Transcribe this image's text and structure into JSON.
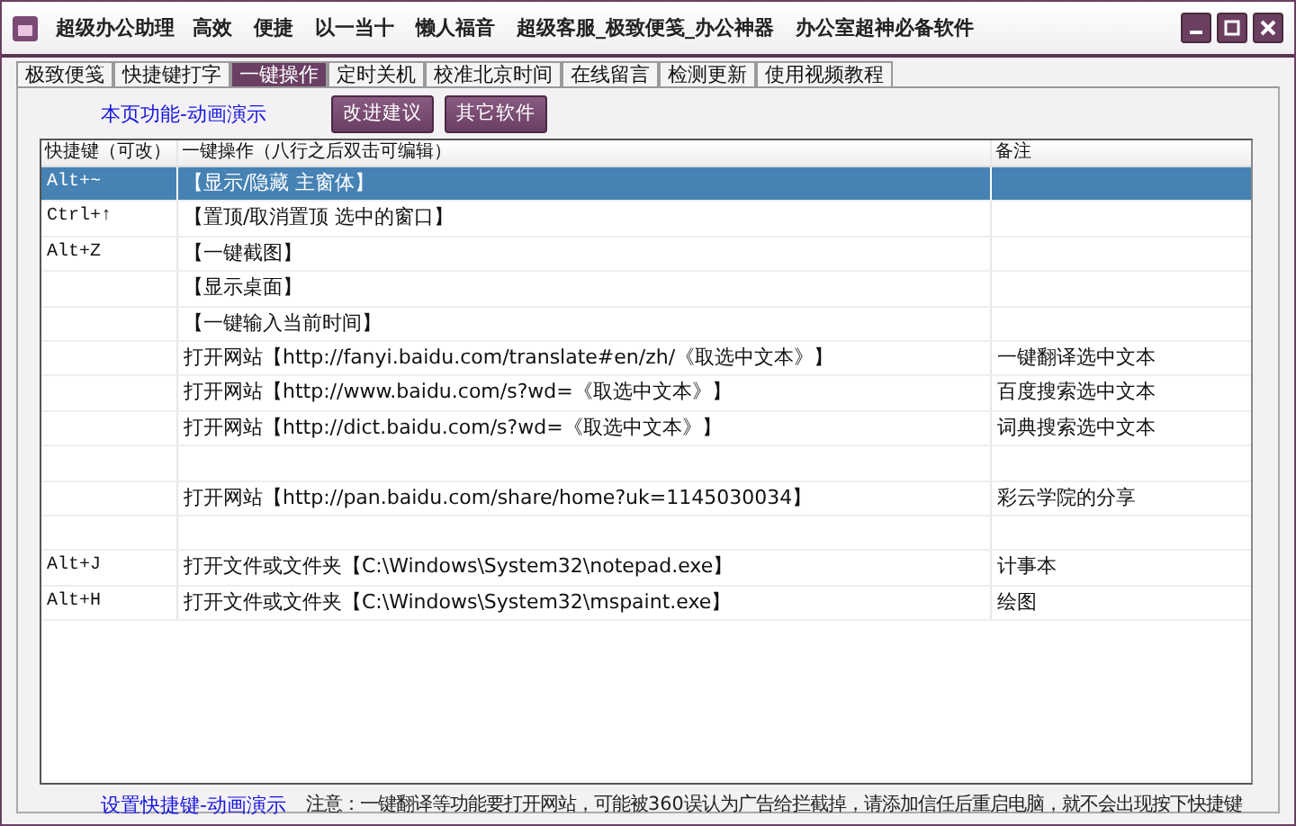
{
  "window": {
    "title": "超级办公助理",
    "slogans": [
      "高效",
      "便捷",
      "以一当十",
      "懒人福音",
      "超级客服_极致便笺_办公神器",
      "办公室超神必备软件"
    ]
  },
  "tabs": [
    {
      "label": "极致便笺",
      "selected": false
    },
    {
      "label": "快捷键打字",
      "selected": false
    },
    {
      "label": "一键操作",
      "selected": true
    },
    {
      "label": "定时关机",
      "selected": false
    },
    {
      "label": "校准北京时间",
      "selected": false
    },
    {
      "label": "在线留言",
      "selected": false
    },
    {
      "label": "检测更新",
      "selected": false
    },
    {
      "label": "使用视频教程",
      "selected": false
    }
  ],
  "toolbar": {
    "link": "本页功能-动画演示",
    "buttons": [
      "改进建议",
      "其它软件"
    ]
  },
  "table": {
    "columns": [
      "快捷键（可改）",
      "一键操作（八行之后双击可编辑）",
      "备注"
    ],
    "rows": [
      {
        "cells": [
          "Alt+~",
          "【显示/隐藏 主窗体】",
          ""
        ],
        "selected": true
      },
      {
        "cells": [
          "Ctrl+↑",
          "【置顶/取消置顶 选中的窗口】",
          ""
        ],
        "selected": false
      },
      {
        "cells": [
          "Alt+Z",
          "【一键截图】",
          ""
        ],
        "selected": false
      },
      {
        "cells": [
          "",
          "【显示桌面】",
          ""
        ],
        "selected": false
      },
      {
        "cells": [
          "",
          "【一键输入当前时间】",
          ""
        ],
        "selected": false
      },
      {
        "cells": [
          "",
          "打开网站【http://fanyi.baidu.com/translate#en/zh/《取选中文本》】",
          "一键翻译选中文本"
        ],
        "selected": false
      },
      {
        "cells": [
          "",
          "打开网站【http://www.baidu.com/s?wd=《取选中文本》】",
          "百度搜索选中文本"
        ],
        "selected": false
      },
      {
        "cells": [
          "",
          "打开网站【http://dict.baidu.com/s?wd=《取选中文本》】",
          "词典搜索选中文本"
        ],
        "selected": false
      },
      {
        "cells": [
          "",
          "",
          ""
        ],
        "selected": false
      },
      {
        "cells": [
          "",
          "打开网站【http://pan.baidu.com/share/home?uk=1145030034】",
          "彩云学院的分享"
        ],
        "selected": false
      },
      {
        "cells": [
          "",
          "",
          ""
        ],
        "selected": false
      },
      {
        "cells": [
          "Alt+J",
          "打开文件或文件夹【C:\\Windows\\System32\\notepad.exe】",
          "计事本"
        ],
        "selected": false
      },
      {
        "cells": [
          "Alt+H",
          "打开文件或文件夹【C:\\Windows\\System32\\mspaint.exe】",
          "绘图"
        ],
        "selected": false
      }
    ]
  },
  "footer": {
    "link": "设置快捷键-动画演示",
    "note": "注意：一键翻译等功能要打开网站，可能被360误认为广告给拦截掉，请添加信任后重启电脑，就不会出现按下快捷键"
  }
}
